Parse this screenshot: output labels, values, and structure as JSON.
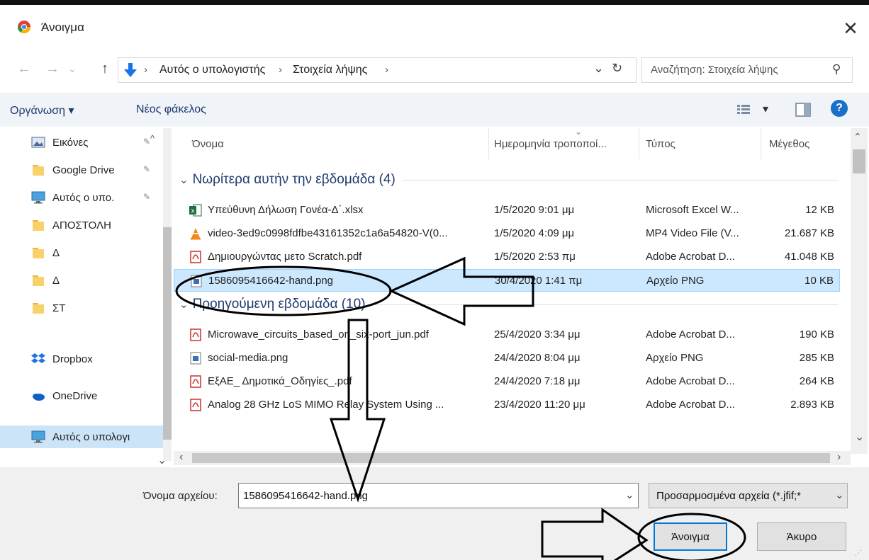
{
  "window": {
    "title": "Άνοιγμα",
    "close_glyph": "✕"
  },
  "nav": {
    "back": "←",
    "forward": "→",
    "recent": "⌄",
    "up": "↑",
    "breadcrumbs": [
      "Αυτός ο υπολογιστής",
      "Στοιχεία λήψης"
    ],
    "sep": "›",
    "dropdown": "⌄",
    "refresh": "↻",
    "search_placeholder": "Αναζήτηση: Στοιχεία λήψης",
    "search_glyph": "⚲"
  },
  "toolbar": {
    "organize": "Οργάνωση ▾",
    "new_folder": "Νέος φάκελος",
    "view_dropdown": "▾",
    "help": "?"
  },
  "sidebar": {
    "items": [
      {
        "label": "Εικόνες",
        "icon": "pictures-icon",
        "pinned": true
      },
      {
        "label": "Google Drive",
        "icon": "folder-icon",
        "pinned": true
      },
      {
        "label": "Αυτός ο υπο.",
        "icon": "computer-icon",
        "pinned": true
      },
      {
        "label": "ΑΠΟΣΤΟΛΗ",
        "icon": "folder-icon",
        "pinned": false
      },
      {
        "label": "Δ",
        "icon": "folder-icon",
        "pinned": false
      },
      {
        "label": "Δ",
        "icon": "folder-icon",
        "pinned": false
      },
      {
        "label": "ΣΤ",
        "icon": "folder-icon",
        "pinned": false
      },
      {
        "label": "Dropbox",
        "icon": "dropbox-icon",
        "pinned": false
      },
      {
        "label": "OneDrive",
        "icon": "onedrive-icon",
        "pinned": false
      },
      {
        "label": "Αυτός ο υπολογι",
        "icon": "computer-icon",
        "pinned": false,
        "selected": true
      }
    ],
    "pin_glyph": "✎"
  },
  "columns": {
    "name": "Όνομα",
    "date": "Ημερομηνία τροποποί...",
    "type": "Τύπος",
    "size": "Μέγεθος"
  },
  "groups": [
    {
      "label": "Νωρίτερα αυτήν την εβδομάδα (4)",
      "rows": [
        {
          "name": "Υπεύθυνη Δήλωση Γονέα-Δ΄.xlsx",
          "date": "1/5/2020 9:01 μμ",
          "type": "Microsoft Excel W...",
          "size": "12 KB",
          "icon": "excel-icon"
        },
        {
          "name": "video-3ed9c0998fdfbe43161352c1a6a54820-V(0...",
          "date": "1/5/2020 4:09 μμ",
          "type": "MP4 Video File (V...",
          "size": "21.687 KB",
          "icon": "vlc-icon"
        },
        {
          "name": "Δημιουργώντας μετο Scratch.pdf",
          "date": "1/5/2020 2:53 πμ",
          "type": "Adobe Acrobat D...",
          "size": "41.048 KB",
          "icon": "pdf-icon"
        },
        {
          "name": "1586095416642-hand.png",
          "date": "30/4/2020 1:41 πμ",
          "type": "Αρχείο PNG",
          "size": "10 KB",
          "icon": "png-icon",
          "selected": true
        }
      ]
    },
    {
      "label": "Προηγούμενη εβδομάδα (10)",
      "rows": [
        {
          "name": "Microwave_circuits_based_on_six-port_jun.pdf",
          "date": "25/4/2020 3:34 μμ",
          "type": "Adobe Acrobat D...",
          "size": "190 KB",
          "icon": "pdf-icon"
        },
        {
          "name": "social-media.png",
          "date": "24/4/2020 8:04 μμ",
          "type": "Αρχείο PNG",
          "size": "285 KB",
          "icon": "png-icon"
        },
        {
          "name": "ΕξΑΕ_ Δημοτικά_Οδηγίες_.pdf",
          "date": "24/4/2020 7:18 μμ",
          "type": "Adobe Acrobat D...",
          "size": "264 KB",
          "icon": "pdf-icon"
        },
        {
          "name": "Analog 28 GHz LoS MIMO Relay System Using ...",
          "date": "23/4/2020 11:20 μμ",
          "type": "Adobe Acrobat D...",
          "size": "2.893 KB",
          "icon": "pdf-icon"
        }
      ]
    }
  ],
  "scroll": {
    "up": "⌃",
    "down": "⌄",
    "left": "‹",
    "right": "›"
  },
  "bottom": {
    "filename_label": "Όνομα αρχείου:",
    "filename_value": "1586095416642-hand.png",
    "filename_dropdown": "⌄",
    "filter": "Προσαρμοσμένα αρχεία (*.jfif;*",
    "filter_dropdown": "⌄",
    "open": "Άνοιγμα",
    "cancel": "Άκυρο"
  }
}
